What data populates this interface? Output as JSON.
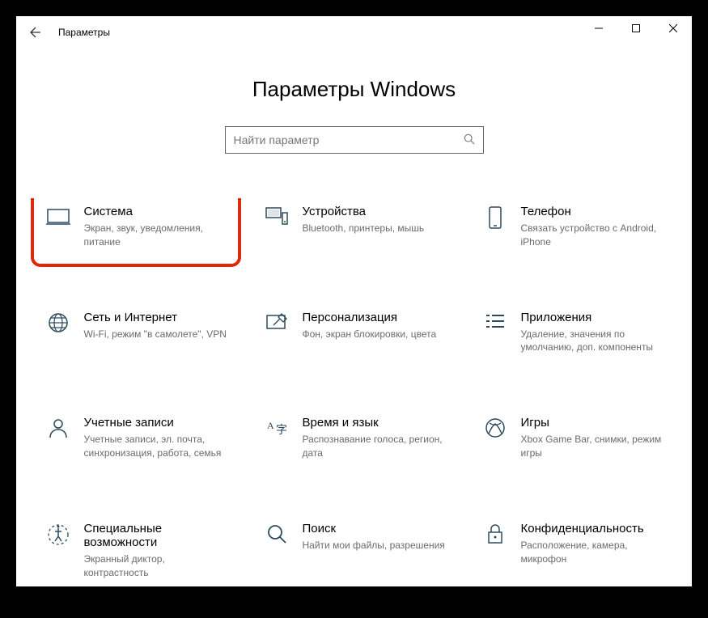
{
  "titlebar": {
    "label": "Параметры"
  },
  "page_title": "Параметры Windows",
  "search": {
    "placeholder": "Найти параметр"
  },
  "tiles": {
    "system": {
      "title": "Система",
      "desc": "Экран, звук, уведомления, питание"
    },
    "devices": {
      "title": "Устройства",
      "desc": "Bluetooth, принтеры, мышь"
    },
    "phone": {
      "title": "Телефон",
      "desc": "Связать устройство с Android, iPhone"
    },
    "network": {
      "title": "Сеть и Интернет",
      "desc": "Wi-Fi, режим \"в самолете\", VPN"
    },
    "personal": {
      "title": "Персонализация",
      "desc": "Фон, экран блокировки, цвета"
    },
    "apps": {
      "title": "Приложения",
      "desc": "Удаление, значения по умолчанию, доп. компоненты"
    },
    "accounts": {
      "title": "Учетные записи",
      "desc": "Учетные записи, эл. почта, синхронизация, работа, семья"
    },
    "time": {
      "title": "Время и язык",
      "desc": "Распознавание голоса, регион, дата"
    },
    "gaming": {
      "title": "Игры",
      "desc": "Xbox Game Bar, снимки, режим игры"
    },
    "accessibility": {
      "title": "Специальные возможности",
      "desc": "Экранный диктор, контрастность"
    },
    "search_tile": {
      "title": "Поиск",
      "desc": "Найти мои файлы, разрешения"
    },
    "privacy": {
      "title": "Конфиденциальность",
      "desc": "Расположение, камера, микрофон"
    }
  }
}
